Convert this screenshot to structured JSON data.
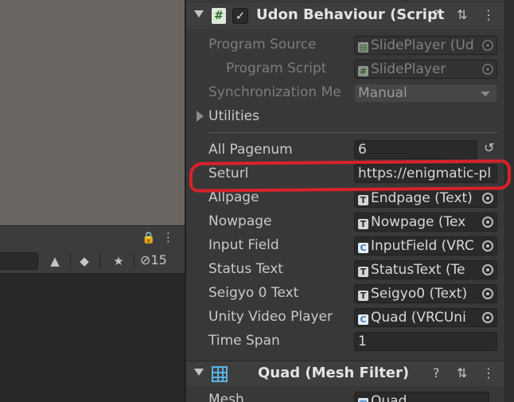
{
  "left_panel": {
    "hidden_count": "15"
  },
  "udon_component": {
    "title": "Udon Behaviour (Script",
    "enabled": true,
    "properties": {
      "program_source": {
        "label": "Program Source",
        "value": "SlidePlayer (Ud"
      },
      "program_script": {
        "label": "Program Script",
        "value": "SlidePlayer"
      },
      "synchronization": {
        "label": "Synchronization Me",
        "value": "Manual"
      },
      "utilities": {
        "label": "Utilities"
      },
      "all_pagenum": {
        "label": "All Pagenum",
        "value": "6"
      },
      "seturl": {
        "label": "Seturl",
        "value": "https://enigmatic-pl"
      },
      "allpage": {
        "label": "Allpage",
        "value": "Endpage (Text)"
      },
      "nowpage": {
        "label": "Nowpage",
        "value": "Nowpage (Tex"
      },
      "input_field": {
        "label": "Input Field",
        "value": "InputField (VRC"
      },
      "status_text": {
        "label": "Status Text",
        "value": "StatusText (Te"
      },
      "seigyo_text": {
        "label": "Seigyo 0 Text",
        "value": "Seigyo0 (Text)"
      },
      "unity_video_player": {
        "label": "Unity Video Player",
        "value": "Quad (VRCUni"
      },
      "time_span": {
        "label": "Time Span",
        "value": "1"
      }
    }
  },
  "mesh_filter_component": {
    "title": "Quad (Mesh Filter)",
    "mesh": {
      "label": "Mesh",
      "value": "Quad"
    }
  },
  "icons": {
    "help": "?",
    "settings": "⇅",
    "menu": "⋮",
    "lock": "🔒",
    "revert": "↺"
  },
  "colors": {
    "annotation": "#d8222a",
    "inspector_bg": "#383838",
    "scene_bg": "#6a6560"
  }
}
